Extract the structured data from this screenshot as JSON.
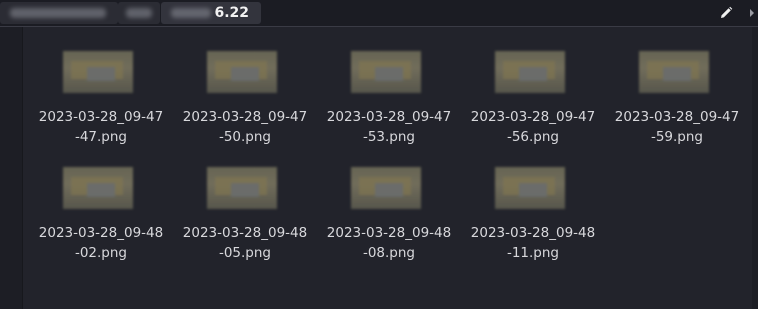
{
  "topbar": {
    "crumbs": [
      {
        "label": ""
      },
      {
        "label": ""
      },
      {
        "label": "6.22"
      }
    ],
    "edit_icon": "pencil-icon",
    "scroll_icon": "chevron-right-icon"
  },
  "files": [
    {
      "line1": "2023-03-28_09-47",
      "line2": "-47.png"
    },
    {
      "line1": "2023-03-28_09-47",
      "line2": "-50.png"
    },
    {
      "line1": "2023-03-28_09-47",
      "line2": "-53.png"
    },
    {
      "line1": "2023-03-28_09-47",
      "line2": "-56.png"
    },
    {
      "line1": "2023-03-28_09-47",
      "line2": "-59.png"
    },
    {
      "line1": "2023-03-28_09-48",
      "line2": "-02.png"
    },
    {
      "line1": "2023-03-28_09-48",
      "line2": "-05.png"
    },
    {
      "line1": "2023-03-28_09-48",
      "line2": "-08.png"
    },
    {
      "line1": "2023-03-28_09-48",
      "line2": "-11.png"
    }
  ],
  "colors": {
    "background": "#22232b",
    "topbar": "#1b1c23",
    "text": "#d8d8dc"
  }
}
